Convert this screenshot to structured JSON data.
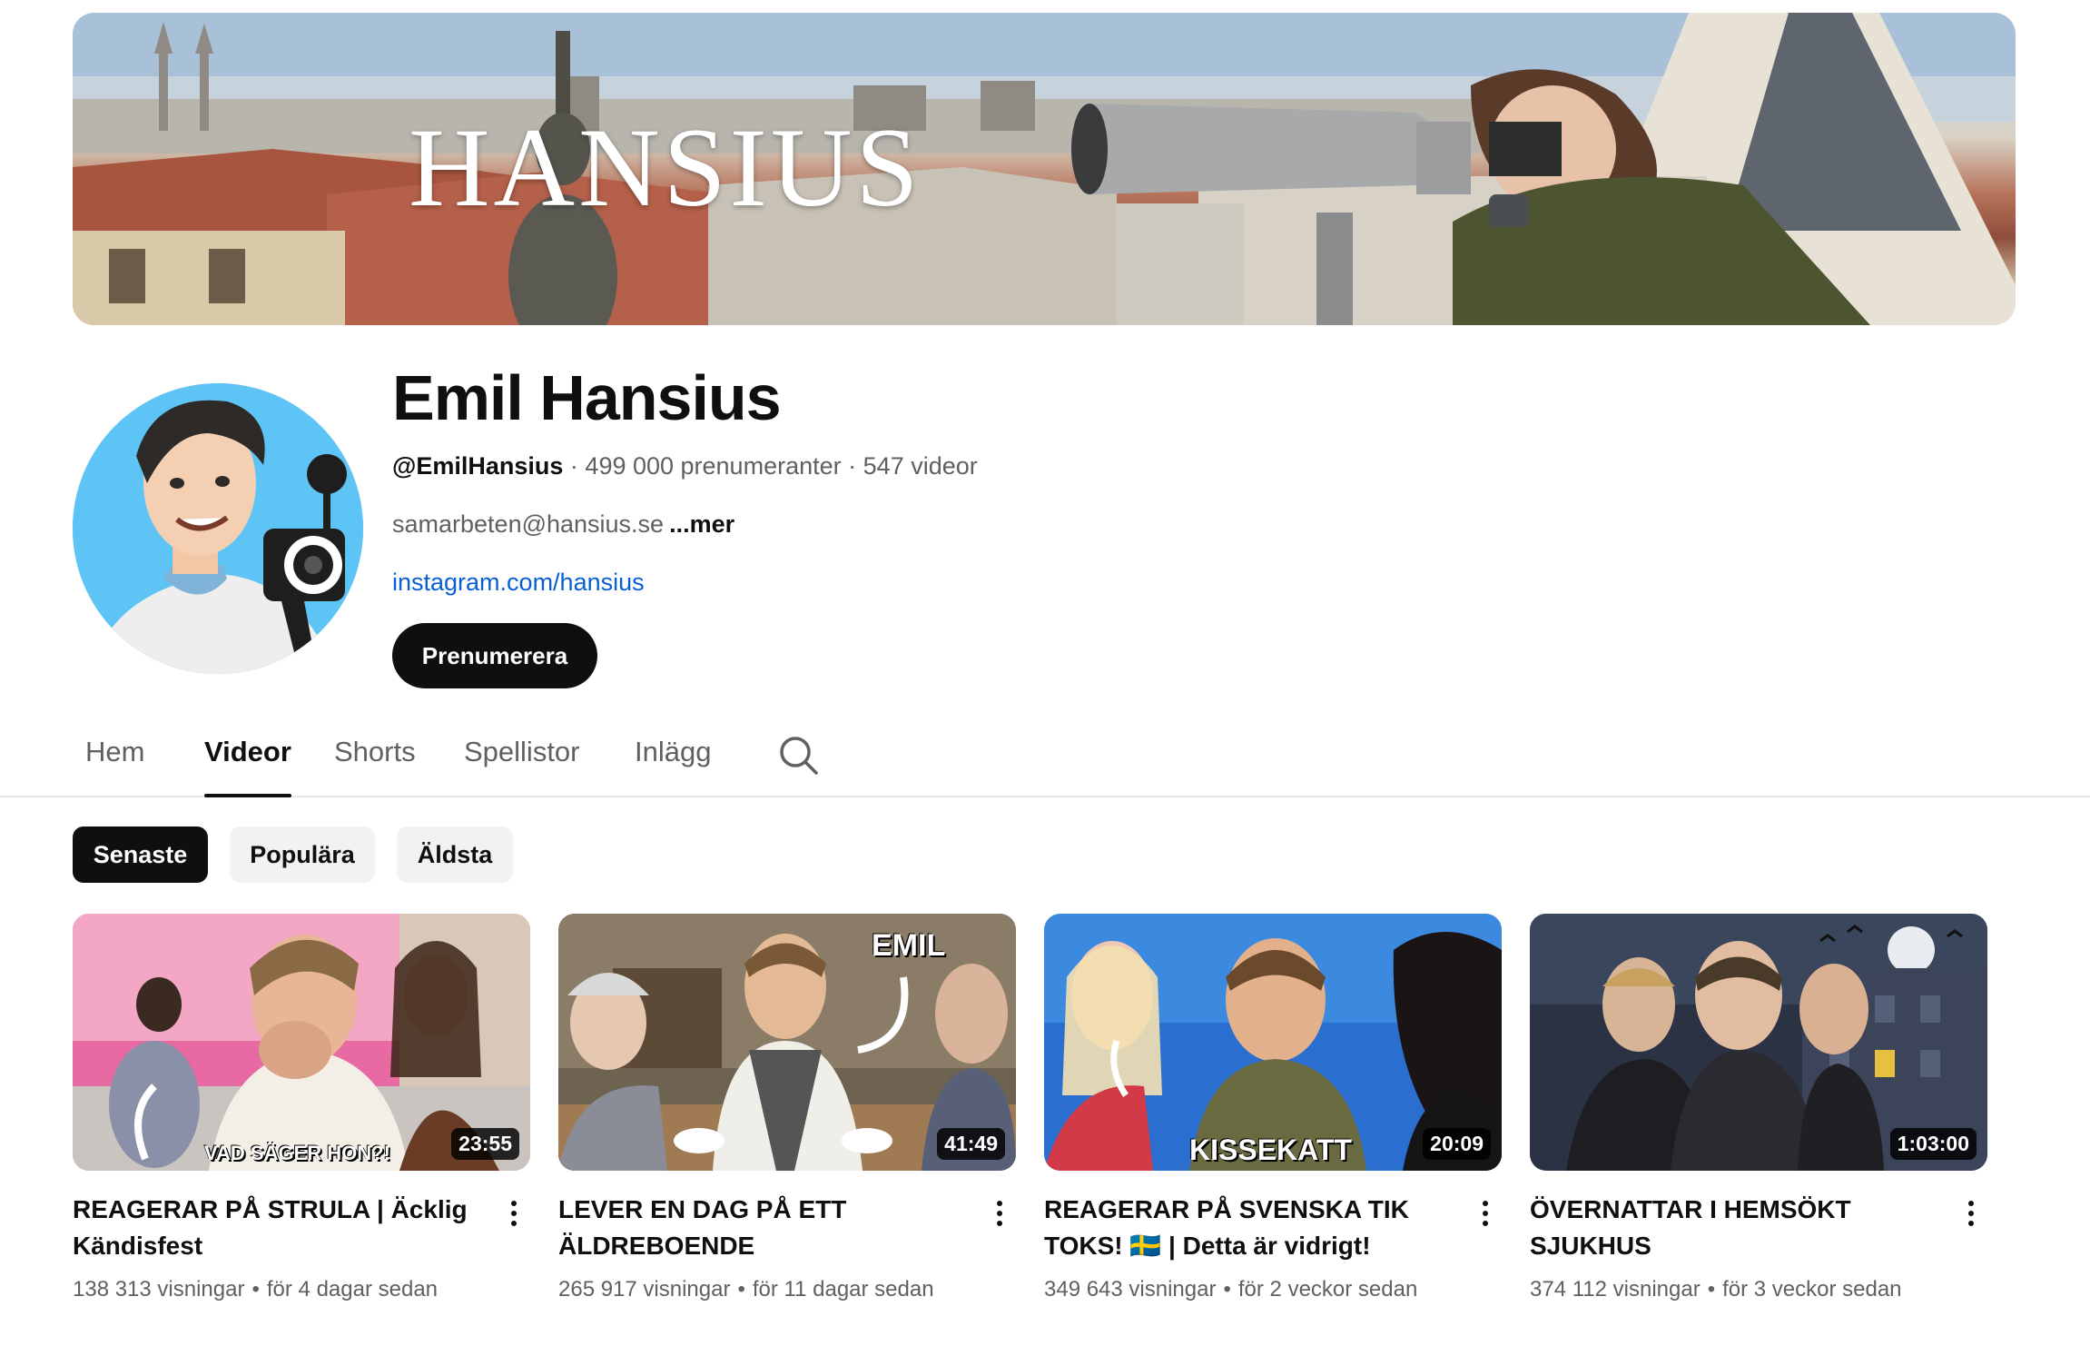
{
  "banner": {
    "logo_text": "HANSIUS"
  },
  "channel": {
    "name": "Emil Hansius",
    "handle": "@EmilHansius",
    "subscribers": "499 000 prenumeranter",
    "video_count": "547 videor",
    "separator": "·",
    "description": "samarbeten@hansius.se",
    "more_label": "...mer",
    "link": "instagram.com/hansius",
    "subscribe_label": "Prenumerera"
  },
  "tabs": [
    {
      "label": "Hem",
      "active": false
    },
    {
      "label": "Videor",
      "active": true
    },
    {
      "label": "Shorts",
      "active": false
    },
    {
      "label": "Spellistor",
      "active": false
    },
    {
      "label": "Inlägg",
      "active": false
    }
  ],
  "chips": [
    {
      "label": "Senaste",
      "active": true
    },
    {
      "label": "Populära",
      "active": false
    },
    {
      "label": "Äldsta",
      "active": false
    }
  ],
  "videos": [
    {
      "title": "REAGERAR PÅ STRULA | Äcklig Kändisfest",
      "duration": "23:55",
      "thumb_text": "VAD SÄGER HON?!",
      "views": "138 313 visningar",
      "age": "för 4 dagar sedan"
    },
    {
      "title": "LEVER EN DAG PÅ ETT ÄLDREBOENDE",
      "duration": "41:49",
      "thumb_text": "EMIL",
      "views": "265 917 visningar",
      "age": "för 11 dagar sedan"
    },
    {
      "title": "REAGERAR PÅ SVENSKA TIK TOKS! 🇸🇪 | Detta är vidrigt!",
      "duration": "20:09",
      "thumb_text": "KISSEKATT",
      "views": "349 643 visningar",
      "age": "för 2 veckor sedan"
    },
    {
      "title": "ÖVERNATTAR I HEMSÖKT SJUKHUS",
      "duration": "1:03:00",
      "thumb_text": "",
      "views": "374 112 visningar",
      "age": "för 3 veckor sedan"
    }
  ],
  "stats_separator": "•",
  "icons": {
    "search": "search-icon",
    "more": "more-vertical-icon"
  },
  "colors": {
    "link": "#065fd4",
    "subscribe_bg": "#0f0f0f",
    "chip_bg": "#f2f2f2",
    "avatar_bg": "#5ec4f5"
  }
}
